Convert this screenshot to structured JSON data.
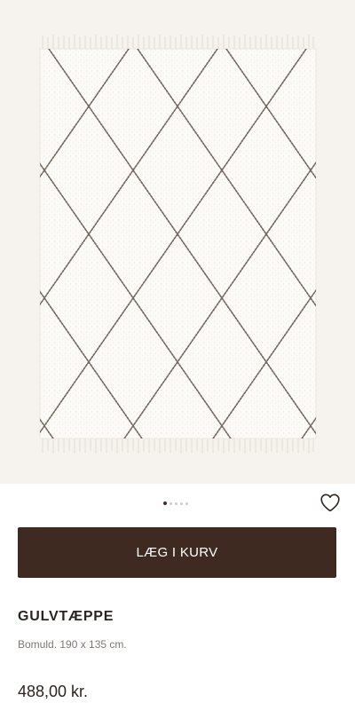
{
  "product": {
    "image_icon": "rug-product-image",
    "gallery": {
      "count": 5,
      "active_index": 0
    },
    "wishlist_icon": "heart-icon",
    "add_to_cart_label": "LÆG I KURV",
    "name": "GULVTÆPPE",
    "description": "Bomuld. 190 x 135 cm.",
    "price": "488,00 kr."
  },
  "colors": {
    "background": "#ffffff",
    "gallery_bg": "#f6f3ee",
    "button": "#3f2a22",
    "button_text": "#ffffff",
    "text_dark": "#2b2420",
    "text_muted": "#7d7773"
  }
}
